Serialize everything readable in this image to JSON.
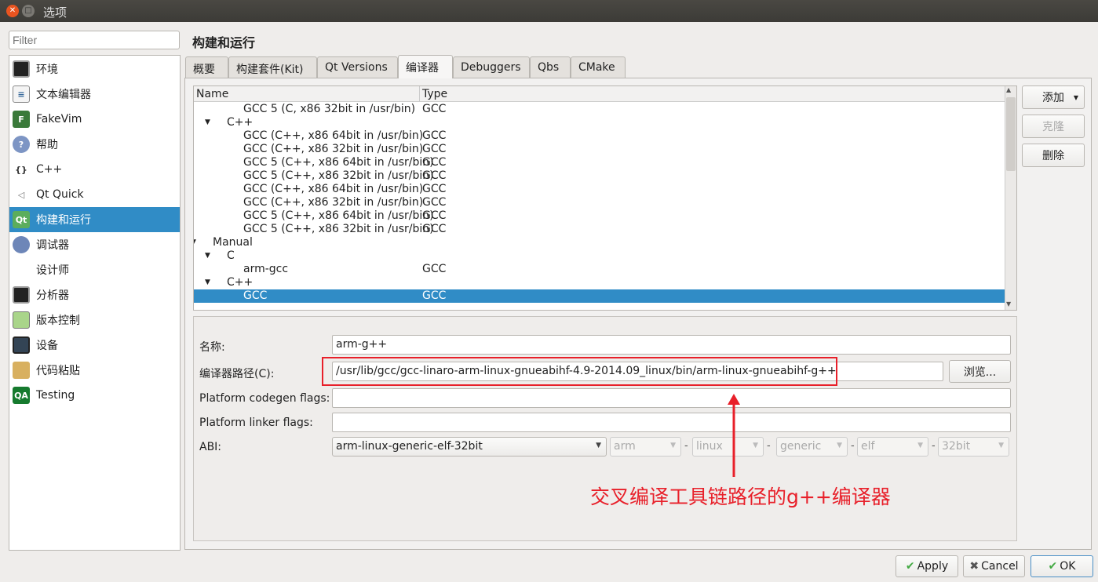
{
  "window": {
    "title": "选项"
  },
  "sidebar": {
    "filter_placeholder": "Filter",
    "items": [
      {
        "label": "环境",
        "icon": "monitor-icon"
      },
      {
        "label": "文本编辑器",
        "icon": "text-document-icon"
      },
      {
        "label": "FakeVim",
        "icon": "fakevim-icon"
      },
      {
        "label": "帮助",
        "icon": "help-icon"
      },
      {
        "label": "C++",
        "icon": "braces-icon"
      },
      {
        "label": "Qt Quick",
        "icon": "paper-plane-icon"
      },
      {
        "label": "构建和运行",
        "icon": "qt-build-icon",
        "selected": true
      },
      {
        "label": "调试器",
        "icon": "bug-icon"
      },
      {
        "label": "设计师",
        "icon": "ruler-brush-icon"
      },
      {
        "label": "分析器",
        "icon": "oscilloscope-icon"
      },
      {
        "label": "版本控制",
        "icon": "documents-icon"
      },
      {
        "label": "设备",
        "icon": "tablet-icon"
      },
      {
        "label": "代码粘贴",
        "icon": "clipboard-globe-icon"
      },
      {
        "label": "Testing",
        "icon": "qa-icon"
      }
    ]
  },
  "page": {
    "title": "构建和运行",
    "tabs": [
      "概要",
      "构建套件(Kit)",
      "Qt Versions",
      "编译器",
      "Debuggers",
      "Qbs",
      "CMake"
    ],
    "active_tab": 3
  },
  "tree": {
    "headers": [
      "Name",
      "Type"
    ],
    "rows": [
      {
        "name": "GCC 5 (C, x86 32bit in /usr/bin)",
        "type": "GCC",
        "level": 2
      },
      {
        "name": "C++",
        "type": "",
        "level": 1,
        "expanded": true
      },
      {
        "name": "GCC (C++, x86 64bit in /usr/bin)",
        "type": "GCC",
        "level": 2
      },
      {
        "name": "GCC (C++, x86 32bit in /usr/bin)",
        "type": "GCC",
        "level": 2
      },
      {
        "name": "GCC 5 (C++, x86 64bit in /usr/bin)",
        "type": "GCC",
        "level": 2
      },
      {
        "name": "GCC 5 (C++, x86 32bit in /usr/bin)",
        "type": "GCC",
        "level": 2
      },
      {
        "name": "GCC (C++, x86 64bit in /usr/bin)",
        "type": "GCC",
        "level": 2
      },
      {
        "name": "GCC (C++, x86 32bit in /usr/bin)",
        "type": "GCC",
        "level": 2
      },
      {
        "name": "GCC 5 (C++, x86 64bit in /usr/bin)",
        "type": "GCC",
        "level": 2
      },
      {
        "name": "GCC 5 (C++, x86 32bit in /usr/bin)",
        "type": "GCC",
        "level": 2
      },
      {
        "name": "Manual",
        "type": "",
        "level": 0,
        "expanded": true
      },
      {
        "name": "C",
        "type": "",
        "level": 1,
        "expanded": true
      },
      {
        "name": "arm-gcc",
        "type": "GCC",
        "level": 2
      },
      {
        "name": "C++",
        "type": "",
        "level": 1,
        "expanded": true
      },
      {
        "name": "GCC",
        "type": "GCC",
        "level": 2,
        "selected": true
      }
    ]
  },
  "side_buttons": {
    "add": "添加",
    "clone": "克隆",
    "remove": "删除"
  },
  "detail": {
    "name_label": "名称:",
    "name_value": "arm-g++",
    "path_label": "编译器路径(C):",
    "path_value": "/usr/lib/gcc/gcc-linaro-arm-linux-gnueabihf-4.9-2014.09_linux/bin/arm-linux-gnueabihf-g++",
    "browse": "浏览...",
    "codegen_label": "Platform codegen flags:",
    "codegen_value": "",
    "linker_label": "Platform linker flags:",
    "linker_value": "",
    "abi_label": "ABI:",
    "abi_value": "arm-linux-generic-elf-32bit",
    "abi_parts": [
      "arm",
      "linux",
      "generic",
      "elf",
      "32bit"
    ]
  },
  "annotation": {
    "text": "交叉编译工具链路径的g++编译器",
    "color": "#e8202a"
  },
  "footer": {
    "apply": "Apply",
    "cancel": "Cancel",
    "ok": "OK"
  },
  "colors": {
    "selection": "#308cc6"
  }
}
